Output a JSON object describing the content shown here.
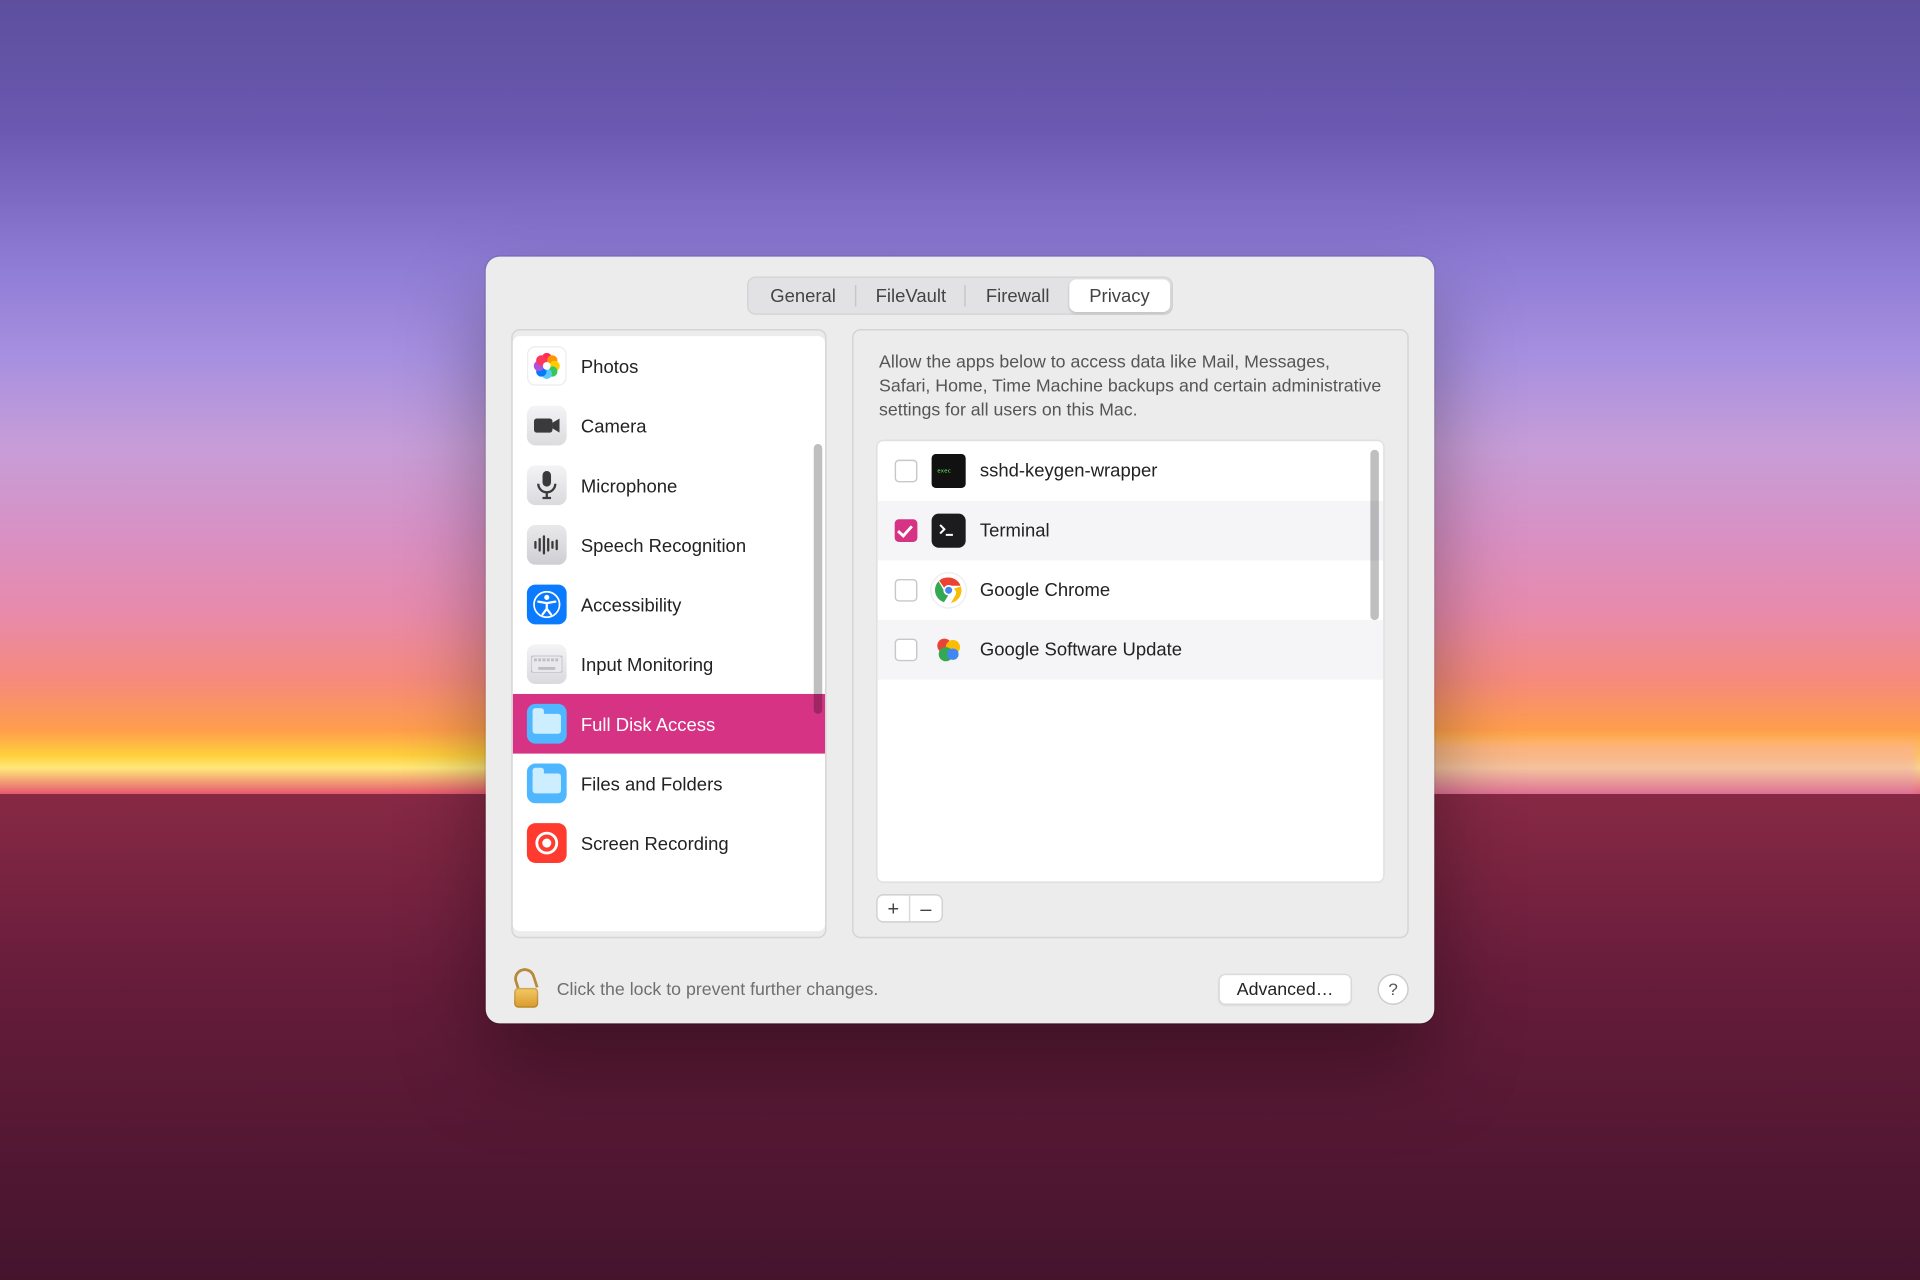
{
  "tabs": [
    "General",
    "FileVault",
    "Firewall",
    "Privacy"
  ],
  "active_tab": "Privacy",
  "categories": [
    {
      "id": "photos",
      "label": "Photos"
    },
    {
      "id": "camera",
      "label": "Camera"
    },
    {
      "id": "microphone",
      "label": "Microphone"
    },
    {
      "id": "speech",
      "label": "Speech Recognition"
    },
    {
      "id": "accessibility",
      "label": "Accessibility"
    },
    {
      "id": "input",
      "label": "Input Monitoring"
    },
    {
      "id": "fda",
      "label": "Full Disk Access"
    },
    {
      "id": "files",
      "label": "Files and Folders"
    },
    {
      "id": "screen",
      "label": "Screen Recording"
    }
  ],
  "selected_category": "fda",
  "description": "Allow the apps below to access data like Mail, Messages, Safari, Home, Time Machine backups and certain administrative settings for all users on this Mac.",
  "apps": [
    {
      "name": "sshd-keygen-wrapper",
      "checked": false,
      "icon": "exec"
    },
    {
      "name": "Terminal",
      "checked": true,
      "icon": "terminal"
    },
    {
      "name": "Google Chrome",
      "checked": false,
      "icon": "chrome"
    },
    {
      "name": "Google Software Update",
      "checked": false,
      "icon": "gsu"
    }
  ],
  "add_label": "+",
  "remove_label": "–",
  "lock_text": "Click the lock to prevent further changes.",
  "advanced_label": "Advanced…",
  "help_label": "?"
}
